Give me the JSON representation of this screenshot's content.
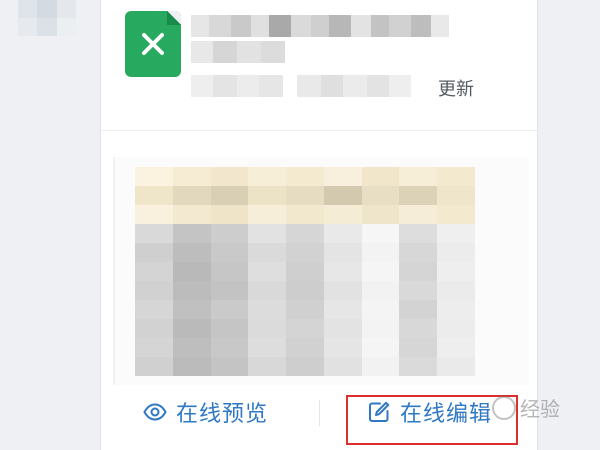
{
  "file_card": {
    "file_type_icon": "excel-x-icon",
    "update_label": "更新"
  },
  "actions": {
    "preview": {
      "label": "在线预览",
      "icon": "eye-icon"
    },
    "edit": {
      "label": "在线编辑",
      "icon": "edit-square-icon"
    }
  },
  "watermark_text": "经验",
  "colors": {
    "accent_blue": "#2f78c4",
    "excel_green": "#27a95f",
    "highlight_red": "#d9302c"
  }
}
